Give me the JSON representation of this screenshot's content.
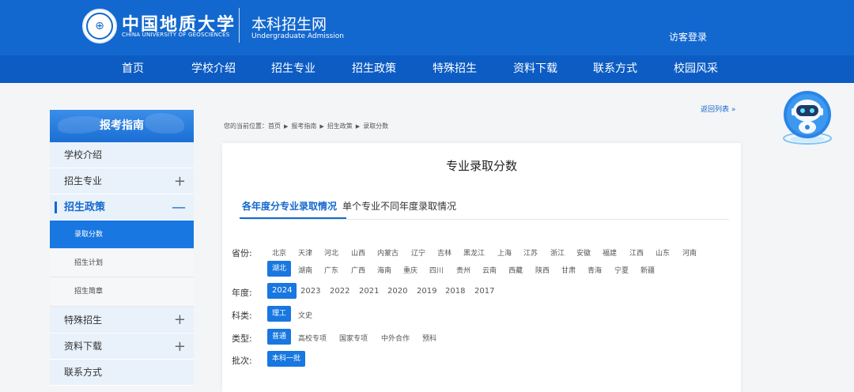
{
  "header": {
    "logo_cn": "中国地质大学",
    "logo_en": "CHINA UNIVERSITY OF GEOSCIENCES",
    "site_cn": "本科招生网",
    "site_en": "Undergraduate Admission",
    "visitor_login": "访客登录",
    "brand_color": "#1368cf"
  },
  "nav": {
    "items": [
      "首页",
      "学校介绍",
      "招生专业",
      "招生政策",
      "特殊招生",
      "资料下载",
      "联系方式",
      "校园风采"
    ]
  },
  "sidebar": {
    "title": "报考指南",
    "items": [
      {
        "label": "学校介绍",
        "sign": ""
      },
      {
        "label": "招生专业",
        "sign": "+"
      },
      {
        "label": "招生政策",
        "sign": "—"
      },
      {
        "label": "特殊招生",
        "sign": "+"
      },
      {
        "label": "资料下载",
        "sign": "+"
      },
      {
        "label": "联系方式",
        "sign": ""
      }
    ],
    "subitems": [
      "录取分数",
      "招生计划",
      "招生简章"
    ]
  },
  "breadcrumb": {
    "prefix": "您的当前位置：",
    "items": [
      "首页",
      "报考指南",
      "招生政策",
      "录取分数"
    ],
    "back": "返回列表 »"
  },
  "content": {
    "title": "专业录取分数",
    "tabs": [
      "各年度分专业录取情况",
      "单个专业不同年度录取情况"
    ],
    "filters": {
      "province_label": "省份:",
      "provinces_row1": [
        "北京",
        "天津",
        "河北",
        "山西",
        "内蒙古",
        "辽宁",
        "吉林",
        "黑龙江",
        "上海",
        "江苏",
        "浙江",
        "安徽",
        "福建",
        "江西",
        "山东",
        "河南"
      ],
      "provinces_row2": [
        "湖北",
        "湖南",
        "广东",
        "广西",
        "海南",
        "重庆",
        "四川",
        "贵州",
        "云南",
        "西藏",
        "陕西",
        "甘肃",
        "青海",
        "宁夏",
        "新疆"
      ],
      "year_label": "年度:",
      "years": [
        "2024",
        "2023",
        "2022",
        "2021",
        "2020",
        "2019",
        "2018",
        "2017"
      ],
      "subject_label": "科类:",
      "subjects": [
        "理工",
        "文史"
      ],
      "type_label": "类型:",
      "types": [
        "普通",
        "高校专项",
        "国家专项",
        "中外合作",
        "预科"
      ],
      "batch_label": "批次:",
      "batches": [
        "本科一批"
      ]
    }
  }
}
